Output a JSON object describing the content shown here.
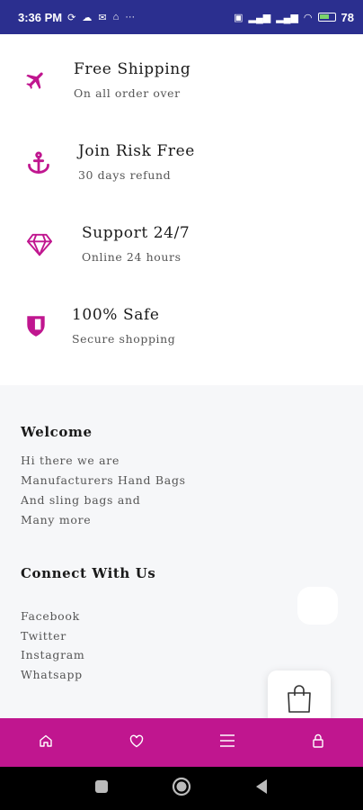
{
  "status_bar": {
    "time": "3:36 PM",
    "battery_percent": "78"
  },
  "features": [
    {
      "icon": "airplane-icon",
      "title": "Free Shipping",
      "subtitle": "On all order over"
    },
    {
      "icon": "anchor-icon",
      "title": "Join Risk Free",
      "subtitle": "30 days refund"
    },
    {
      "icon": "diamond-icon",
      "title": "Support 24/7",
      "subtitle": "Online 24 hours"
    },
    {
      "icon": "shield-icon",
      "title": "100% Safe",
      "subtitle": "Secure shopping"
    }
  ],
  "footer": {
    "welcome_title": "Welcome",
    "welcome_lines": [
      "Hi there we are",
      "Manufacturers Hand Bags",
      "And sling bags and",
      "Many more"
    ],
    "connect_title": "Connect With Us",
    "social_links": [
      "Facebook",
      "Twitter",
      "Instagram",
      "Whatsapp"
    ]
  },
  "bottom_nav": {
    "items": [
      {
        "icon": "home-icon"
      },
      {
        "icon": "heart-icon"
      },
      {
        "icon": "menu-icon"
      },
      {
        "icon": "lock-icon"
      }
    ]
  },
  "colors": {
    "accent": "#c0168f",
    "status_bar": "#2b2f8f",
    "footer_bg": "#f6f7f9"
  }
}
